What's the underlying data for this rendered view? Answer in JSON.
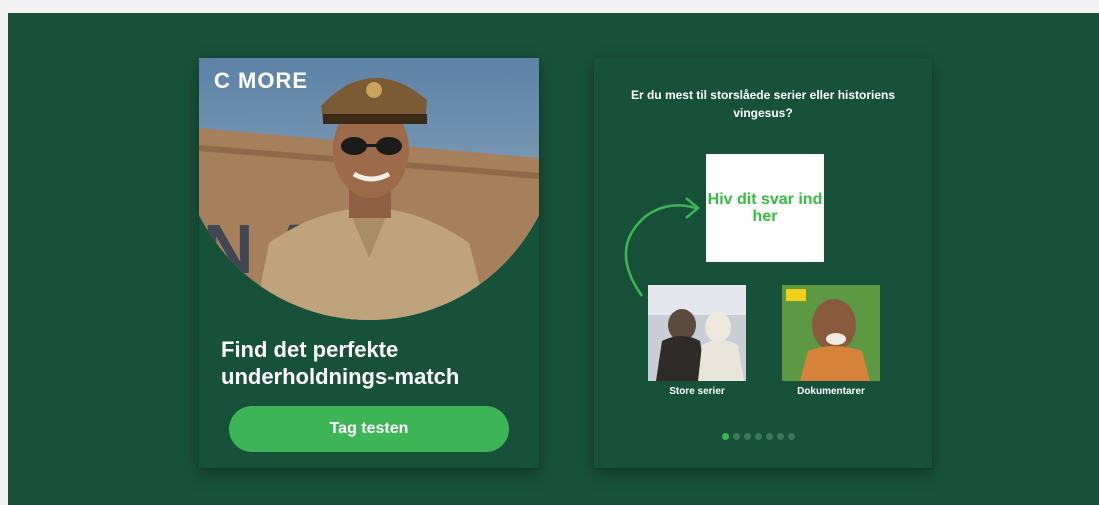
{
  "left_card": {
    "brand": "C MORE",
    "headline": "Find det perfekte underholdnings-match",
    "cta_label": "Tag testen"
  },
  "right_card": {
    "question": "Er du mest til storslåede serier eller historiens vingesus?",
    "dropzone_text": "Hiv dit svar ind her",
    "options": [
      {
        "label": "Store serier"
      },
      {
        "label": "Dokumentarer"
      }
    ],
    "pagination": {
      "count": 7,
      "active_index": 0
    }
  },
  "colors": {
    "background": "#18523a",
    "accent": "#3db556",
    "dropzone_text": "#2fbf3c"
  }
}
